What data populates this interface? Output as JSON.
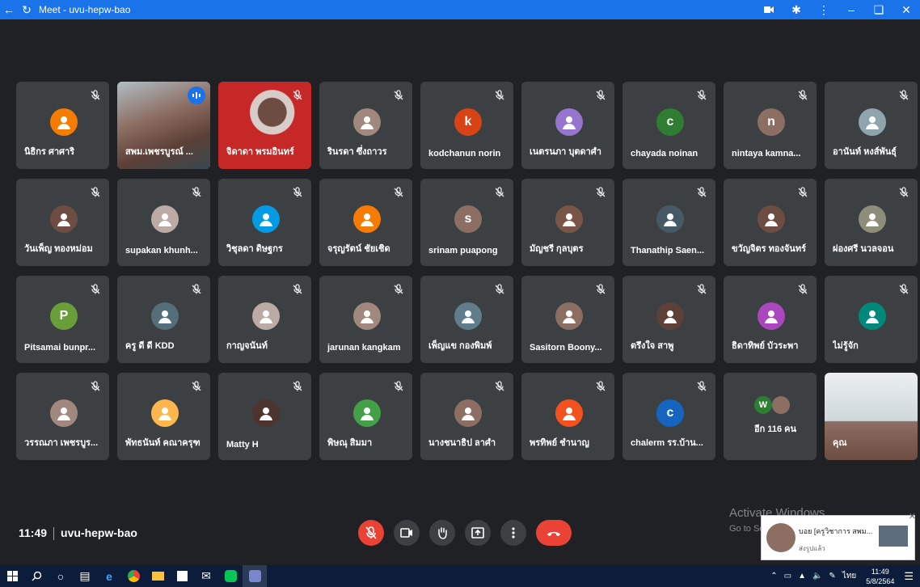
{
  "window": {
    "title": "Meet - uvu-hepw-bao"
  },
  "tiles": [
    {
      "name": "นิธิกร ศาศาริ",
      "type": "avatar",
      "letter": "",
      "color": "#f57c00"
    },
    {
      "name": "สพม.เพชรบูรณ์ ...",
      "type": "photo",
      "letter": "",
      "color": "#8d6e63"
    },
    {
      "name": "จิดาดา พรมอินทร์",
      "type": "photo",
      "letter": "",
      "color": "#efebe9"
    },
    {
      "name": "รินรดา ซึ่งถาวร",
      "type": "avatar",
      "letter": "",
      "color": "#a1887f"
    },
    {
      "name": "kodchanun norin",
      "type": "avatar",
      "letter": "k",
      "color": "#d84315"
    },
    {
      "name": "เนตรนภา บุตดาศำ",
      "type": "avatar",
      "letter": "",
      "color": "#9575cd"
    },
    {
      "name": "chayada noinan",
      "type": "avatar",
      "letter": "c",
      "color": "#2e7d32"
    },
    {
      "name": "nintaya kamna...",
      "type": "avatar",
      "letter": "n",
      "color": "#8d6e63"
    },
    {
      "name": "อานันท์ หงส์พันธุ์",
      "type": "avatar",
      "letter": "",
      "color": "#90a4ae"
    },
    {
      "name": "วันเพ็ญ ทองหม่อม",
      "type": "avatar",
      "letter": "",
      "color": "#6d4c41"
    },
    {
      "name": "supakan khunh...",
      "type": "avatar",
      "letter": "",
      "color": "#bcaaa4"
    },
    {
      "name": "วิชุลดา ดิษฐกร",
      "type": "avatar",
      "letter": "",
      "color": "#039be5"
    },
    {
      "name": "จรุญรัตน์ ชัยเชิด",
      "type": "avatar",
      "letter": "",
      "color": "#f57c00"
    },
    {
      "name": "srinam puapong",
      "type": "avatar",
      "letter": "s",
      "color": "#8d6e63"
    },
    {
      "name": "มัญชรี กุลบุตร",
      "type": "avatar",
      "letter": "",
      "color": "#795548"
    },
    {
      "name": "Thanathip Saen...",
      "type": "avatar",
      "letter": "",
      "color": "#455a64"
    },
    {
      "name": "ขวัญจิตร ทองจันทร์",
      "type": "avatar",
      "letter": "",
      "color": "#6d4c41"
    },
    {
      "name": "ผ่องศรี นวลจอน",
      "type": "avatar",
      "letter": "",
      "color": "#8d8d7a"
    },
    {
      "name": "Pitsamai bunpr...",
      "type": "avatar",
      "letter": "P",
      "color": "#689f38"
    },
    {
      "name": "ครู ดี ดี KDD",
      "type": "avatar",
      "letter": "",
      "color": "#546e7a"
    },
    {
      "name": "กาญจนันท์",
      "type": "avatar",
      "letter": "",
      "color": "#bcaaa4"
    },
    {
      "name": "jarunan kangkam",
      "type": "avatar",
      "letter": "",
      "color": "#a1887f"
    },
    {
      "name": "เพ็ญแข กองพิมพ์",
      "type": "avatar",
      "letter": "",
      "color": "#607d8b"
    },
    {
      "name": "Sasitorn Boony...",
      "type": "avatar",
      "letter": "",
      "color": "#8d6e63"
    },
    {
      "name": "ตรึงใจ สาพู",
      "type": "avatar",
      "letter": "",
      "color": "#5d4037"
    },
    {
      "name": "ธิดาทิพย์ บัวระพา",
      "type": "avatar",
      "letter": "",
      "color": "#ab47bc"
    },
    {
      "name": "ไม่รู้จัก",
      "type": "avatar",
      "letter": "",
      "color": "#00897b"
    },
    {
      "name": "วรรณภา เพชรบูร...",
      "type": "avatar",
      "letter": "",
      "color": "#a1887f"
    },
    {
      "name": "พัทธนันท์ คณาครุฑ",
      "type": "avatar",
      "letter": "",
      "color": "#ffb74d"
    },
    {
      "name": "Matty H",
      "type": "avatar",
      "letter": "",
      "color": "#4e342e"
    },
    {
      "name": "พิษณุ สิมมา",
      "type": "avatar",
      "letter": "",
      "color": "#43a047"
    },
    {
      "name": "นางชนาธิป ลาศำ",
      "type": "avatar",
      "letter": "",
      "color": "#8d6e63"
    },
    {
      "name": "พรทิพย์ ชำนาญ",
      "type": "avatar",
      "letter": "",
      "color": "#f4511e"
    },
    {
      "name": "chalerm รร.บ้าน...",
      "type": "avatar",
      "letter": "c",
      "color": "#1565c0"
    },
    {
      "name": "อีก 116 คน",
      "type": "more",
      "letter": "W",
      "color": "#2e7d32"
    },
    {
      "name": "คุณ",
      "type": "self",
      "letter": "",
      "color": "#b0bec5"
    }
  ],
  "meeting": {
    "time": "11:49",
    "code": "uvu-hepw-bao"
  },
  "watermark": {
    "line1": "Activate Windows",
    "line2": "Go to Se"
  },
  "notification": {
    "title": "บอย [ครูวิชาการ สพม...",
    "subtitle": "ส่งรูปแล้ว"
  },
  "taskbar": {
    "lang": "ไทย",
    "time": "11:49",
    "date": "5/8/2564"
  },
  "colors": {
    "accent": "#1a73e8",
    "danger": "#ea4335",
    "tile": "#3c4043",
    "background": "#202124"
  }
}
